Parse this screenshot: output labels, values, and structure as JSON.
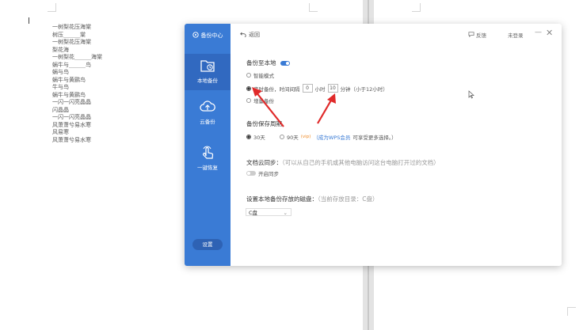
{
  "document": {
    "lines": [
      "一树梨花压海棠",
      "树压______棠",
      "一树梨花压海棠",
      "梨花海",
      "一树梨花______海棠",
      "蜗牛与______鸟",
      "蜗与鸟",
      "蜗牛与黄鹂鸟",
      "牛与鸟",
      "蜗牛与黄鹂鸟",
      "一闪一闪亮晶晶",
      "闪晶晶",
      "一闪一闪亮晶晶",
      "风萧萧兮易水寒",
      "风易寒",
      "风萧萧兮易水寒"
    ]
  },
  "dialog": {
    "sidebar": {
      "title": "备份中心",
      "items": [
        {
          "label": "本地备份",
          "icon": "folder-clock-icon"
        },
        {
          "label": "云备份",
          "icon": "cloud-upload-icon"
        },
        {
          "label": "一键恢复",
          "icon": "hand-restore-icon"
        }
      ],
      "settings_label": "设置"
    },
    "topbar": {
      "back_label": "返回",
      "feedback_label": "反馈",
      "login_label": "未登录",
      "minimize_label": "—",
      "close_label": "✕"
    },
    "backup_local": {
      "title": "备份至本地",
      "option_smart": "智能模式",
      "option_timed_prefix": "定时备份，时间间隔",
      "hours_value": "0",
      "hours_unit": "小时",
      "minutes_value": "10",
      "minutes_unit": "分钟（小于12小时）",
      "option_other": "增量备份"
    },
    "retention": {
      "title": "备份保存周期",
      "option_30": "30天",
      "option_90": "90天",
      "vip_badge": "(vip)",
      "promo_link": "（成为WPS会员",
      "promo_rest": "可享受更多选择。）"
    },
    "cloud_sync": {
      "title": "文档云同步：",
      "hint": "（可以从自己的手机或其他电脑访问这台电脑打开过的文档）",
      "toggle_label": "开启同步"
    },
    "disk": {
      "title": "设置本地备份存放的磁盘：",
      "hint": "（当前存放目录：C盘）",
      "selected": "C盘"
    }
  },
  "colors": {
    "sidebar": "#3a7bd5",
    "arrow": "#e02a2a"
  }
}
